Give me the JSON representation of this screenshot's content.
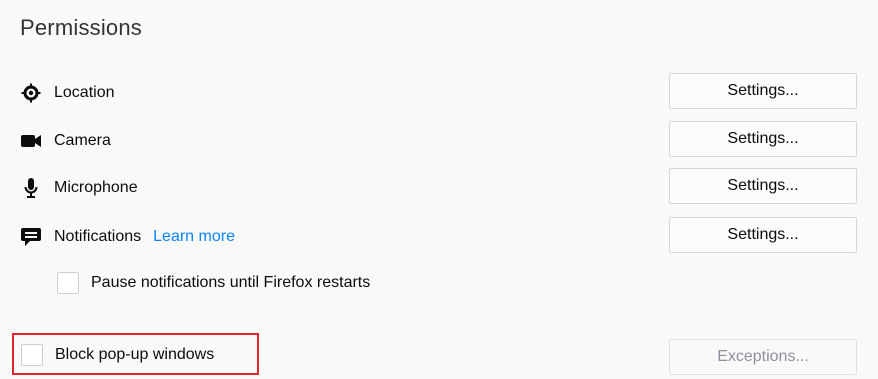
{
  "section": {
    "title": "Permissions"
  },
  "permissions": [
    {
      "icon": "location-icon",
      "label": "Location",
      "button": "Settings..."
    },
    {
      "icon": "camera-icon",
      "label": "Camera",
      "button": "Settings..."
    },
    {
      "icon": "microphone-icon",
      "label": "Microphone",
      "button": "Settings..."
    },
    {
      "icon": "notifications-icon",
      "label": "Notifications",
      "link": "Learn more",
      "button": "Settings..."
    }
  ],
  "pause_notifications": {
    "label": "Pause notifications until Firefox restarts",
    "checked": false
  },
  "block_popups": {
    "label": "Block pop-up windows",
    "checked": false,
    "button": "Exceptions...",
    "button_enabled": false
  },
  "colors": {
    "link": "#0a84ff",
    "highlight_border": "#e3262d",
    "background": "#f9f9fa"
  }
}
